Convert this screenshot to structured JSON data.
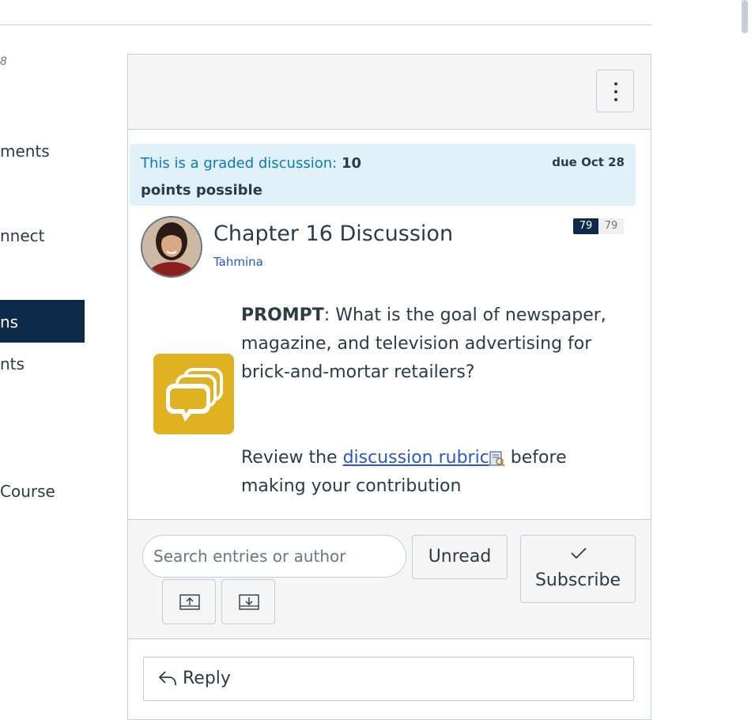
{
  "left_nav": {
    "date_fragment": "8",
    "items": [
      {
        "label": "ments"
      },
      {
        "label": "nnect"
      },
      {
        "label": "ns"
      },
      {
        "label": "nts"
      },
      {
        "label": "Course"
      }
    ]
  },
  "discussion": {
    "graded_label": "This is a graded discussion:",
    "points_value": "10",
    "points_suffix": "points possible",
    "due": "due Oct 28",
    "title": "Chapter 16 Discussion",
    "author": "Tahmina",
    "unread_count": "79",
    "total_count": "79",
    "prompt_label": "PROMPT",
    "prompt_text": ": What is the goal of newspaper, magazine, and television advertising for brick-and-mortar retailers?",
    "review_prefix": "Review the ",
    "rubric_link": "discussion rubric",
    "review_suffix": " before making your contribution"
  },
  "toolbar": {
    "search_placeholder": "Search entries or author",
    "unread_label": "Unread",
    "subscribe_label": "Subscribe"
  },
  "reply_label": "Reply",
  "colors": {
    "nav_active": "#0e2a4a",
    "graded_banner": "#e0f1fa",
    "graded_text": "#0b7bb8",
    "link": "#2b58c2",
    "discussion_icon_bg": "#e0b221"
  }
}
